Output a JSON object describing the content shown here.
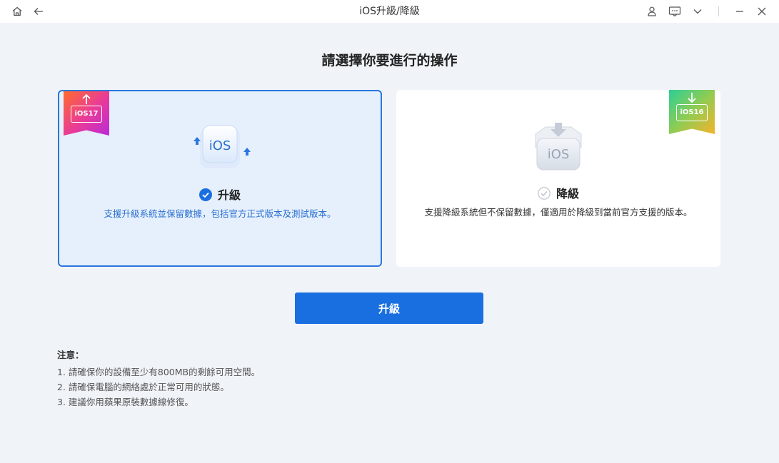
{
  "window": {
    "title": "iOS升級/降級",
    "icons": [
      "home-icon",
      "back-icon",
      "user-icon",
      "feedback-icon",
      "chevron-down-icon",
      "minimize-icon",
      "close-icon"
    ]
  },
  "heading": "請選擇你要進行的操作",
  "options": {
    "upgrade": {
      "badge": "iOS17",
      "illustration": "iOS",
      "label": "升級",
      "description": "支援升級系統並保留數據，包括官方正式版本及測試版本。",
      "selected": true
    },
    "downgrade": {
      "badge": "iOS16",
      "illustration": "iOS",
      "label": "降級",
      "description": "支援降級系統但不保留數據，僅適用於降級到當前官方支援的版本。",
      "selected": false
    }
  },
  "action_button": "升級",
  "notes": {
    "title": "注意：",
    "items": [
      "1.  請確保你的設備至少有800MB的剩餘可用空間。",
      "2.  請確保電腦的網絡處於正常可用的狀態。",
      "3.  建議你用蘋果原裝數據線修復。"
    ]
  },
  "colors": {
    "accent": "#1a6fe0",
    "background": "#f0f4f9",
    "selected_card": "#e6f0fd"
  }
}
